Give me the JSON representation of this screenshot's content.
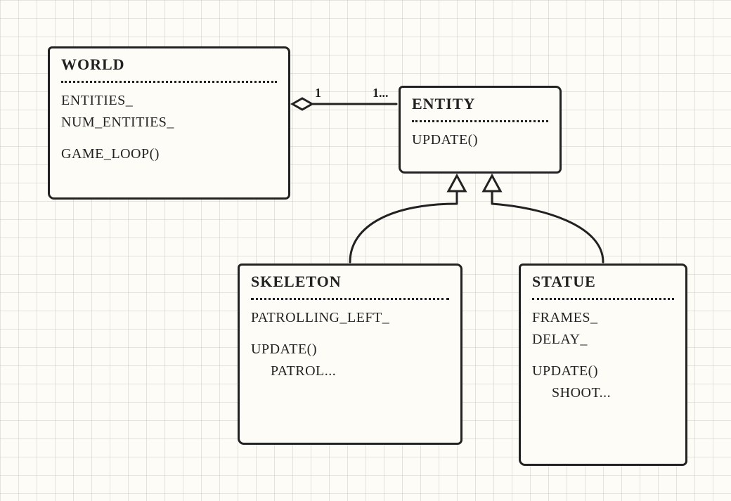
{
  "classes": {
    "world": {
      "name": "WORLD",
      "attrs": [
        "ENTITIES_",
        "NUM_ENTITIES_"
      ],
      "methods": [
        "GAME_LOOP()"
      ]
    },
    "entity": {
      "name": "ENTITY",
      "attrs": [],
      "methods": [
        "UPDATE()"
      ]
    },
    "skeleton": {
      "name": "SKELETON",
      "attrs": [
        "PATROLLING_LEFT_"
      ],
      "methods": [
        "UPDATE()",
        "PATROL..."
      ]
    },
    "statue": {
      "name": "STATUE",
      "attrs": [
        "FRAMES_",
        "DELAY_"
      ],
      "methods": [
        "UPDATE()",
        "SHOOT..."
      ]
    }
  },
  "relations": {
    "aggregation": {
      "from": "world",
      "to": "entity",
      "mult_from": "1",
      "mult_to": "1..."
    },
    "inherit1": {
      "from": "skeleton",
      "to": "entity"
    },
    "inherit2": {
      "from": "statue",
      "to": "entity"
    }
  }
}
